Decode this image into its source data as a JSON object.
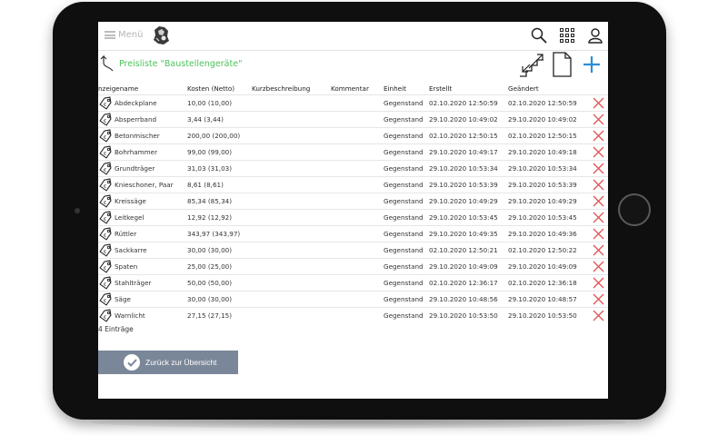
{
  "app": {
    "menu_label": "Menü"
  },
  "page": {
    "title": "Preisliste \"Baustellengeräte\""
  },
  "columns": [
    "nzeigename",
    "Kosten (Netto)",
    "Kurzbeschreibung",
    "Kommentar",
    "Einheit",
    "Erstellt",
    "Geändert"
  ],
  "rows": [
    {
      "name": "Abdeckplane",
      "cost": "10,00 (10,00)",
      "short": "",
      "comment": "",
      "unit": "Gegenstand",
      "created": "02.10.2020 12:50:59",
      "changed": "02.10.2020 12:50:59"
    },
    {
      "name": "Absperrband",
      "cost": "3,44 (3,44)",
      "short": "",
      "comment": "",
      "unit": "Gegenstand",
      "created": "29.10.2020 10:49:02",
      "changed": "29.10.2020 10:49:02"
    },
    {
      "name": "Betonmischer",
      "cost": "200,00 (200,00)",
      "short": "",
      "comment": "",
      "unit": "Gegenstand",
      "created": "02.10.2020 12:50:15",
      "changed": "02.10.2020 12:50:15"
    },
    {
      "name": "Bohrhammer",
      "cost": "99,00 (99,00)",
      "short": "",
      "comment": "",
      "unit": "Gegenstand",
      "created": "29.10.2020 10:49:17",
      "changed": "29.10.2020 10:49:18"
    },
    {
      "name": "Grundträger",
      "cost": "31,03 (31,03)",
      "short": "",
      "comment": "",
      "unit": "Gegenstand",
      "created": "29.10.2020 10:53:34",
      "changed": "29.10.2020 10:53:34"
    },
    {
      "name": "Knieschoner, Paar",
      "cost": "8,61 (8,61)",
      "short": "",
      "comment": "",
      "unit": "Gegenstand",
      "created": "29.10.2020 10:53:39",
      "changed": "29.10.2020 10:53:39"
    },
    {
      "name": "Kreissäge",
      "cost": "85,34 (85,34)",
      "short": "",
      "comment": "",
      "unit": "Gegenstand",
      "created": "29.10.2020 10:49:29",
      "changed": "29.10.2020 10:49:29"
    },
    {
      "name": "Leitkegel",
      "cost": "12,92 (12,92)",
      "short": "",
      "comment": "",
      "unit": "Gegenstand",
      "created": "29.10.2020 10:53:45",
      "changed": "29.10.2020 10:53:45"
    },
    {
      "name": "Rüttler",
      "cost": "343,97 (343,97)",
      "short": "",
      "comment": "",
      "unit": "Gegenstand",
      "created": "29.10.2020 10:49:35",
      "changed": "29.10.2020 10:49:36"
    },
    {
      "name": "Sackkarre",
      "cost": "30,00 (30,00)",
      "short": "",
      "comment": "",
      "unit": "Gegenstand",
      "created": "02.10.2020 12:50:21",
      "changed": "02.10.2020 12:50:22"
    },
    {
      "name": "Spaten",
      "cost": "25,00 (25,00)",
      "short": "",
      "comment": "",
      "unit": "Gegenstand",
      "created": "29.10.2020 10:49:09",
      "changed": "29.10.2020 10:49:09"
    },
    {
      "name": "Stahlträger",
      "cost": "50,00 (50,00)",
      "short": "",
      "comment": "",
      "unit": "Gegenstand",
      "created": "02.10.2020 12:36:17",
      "changed": "02.10.2020 12:36:18"
    },
    {
      "name": "Säge",
      "cost": "30,00 (30,00)",
      "short": "",
      "comment": "",
      "unit": "Gegenstand",
      "created": "29.10.2020 10:48:56",
      "changed": "29.10.2020 10:48:57"
    },
    {
      "name": "Warnlicht",
      "cost": "27,15 (27,15)",
      "short": "",
      "comment": "",
      "unit": "Gegenstand",
      "created": "29.10.2020 10:53:50",
      "changed": "29.10.2020 10:53:50"
    }
  ],
  "footer": {
    "count_text": "4 Einträge",
    "back_button_label": "Zurück zur Übersicht"
  },
  "icons": {
    "menu": "hamburger-icon",
    "logo": "company-logo",
    "search": "search-icon",
    "apps": "grid-icon",
    "user": "user-icon",
    "back": "back-arrow-icon",
    "import_export": "stairs-arrows-icon",
    "document": "document-icon",
    "add": "plus-icon",
    "row": "price-tag-icon",
    "delete": "close-icon",
    "confirm": "check-icon"
  },
  "colors": {
    "title_green": "#4cc35a",
    "add_blue": "#2b8fd6",
    "delete_red": "#e05555",
    "back_button_bg": "#7a8799"
  }
}
